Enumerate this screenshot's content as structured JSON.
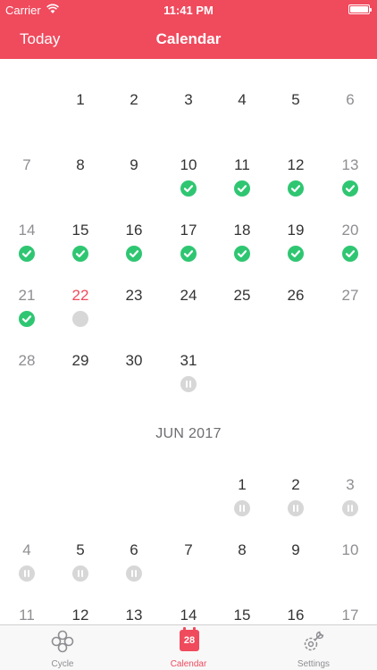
{
  "status_bar": {
    "carrier": "Carrier",
    "time": "11:41 PM"
  },
  "nav": {
    "today_label": "Today",
    "title": "Calendar"
  },
  "calendar": {
    "may": [
      {
        "d": "1",
        "col": 1,
        "row": 0
      },
      {
        "d": "2",
        "col": 2,
        "row": 0
      },
      {
        "d": "3",
        "col": 3,
        "row": 0
      },
      {
        "d": "4",
        "col": 4,
        "row": 0
      },
      {
        "d": "5",
        "col": 5,
        "row": 0
      },
      {
        "d": "6",
        "col": 6,
        "row": 0
      },
      {
        "d": "7",
        "col": 0,
        "row": 1
      },
      {
        "d": "8",
        "col": 1,
        "row": 1
      },
      {
        "d": "9",
        "col": 2,
        "row": 1
      },
      {
        "d": "10",
        "col": 3,
        "row": 1,
        "m": "check"
      },
      {
        "d": "11",
        "col": 4,
        "row": 1,
        "m": "check"
      },
      {
        "d": "12",
        "col": 5,
        "row": 1,
        "m": "check"
      },
      {
        "d": "13",
        "col": 6,
        "row": 1,
        "m": "check"
      },
      {
        "d": "14",
        "col": 0,
        "row": 2,
        "m": "check"
      },
      {
        "d": "15",
        "col": 1,
        "row": 2,
        "m": "check"
      },
      {
        "d": "16",
        "col": 2,
        "row": 2,
        "m": "check"
      },
      {
        "d": "17",
        "col": 3,
        "row": 2,
        "m": "check"
      },
      {
        "d": "18",
        "col": 4,
        "row": 2,
        "m": "check"
      },
      {
        "d": "19",
        "col": 5,
        "row": 2,
        "m": "check"
      },
      {
        "d": "20",
        "col": 6,
        "row": 2,
        "m": "check"
      },
      {
        "d": "21",
        "col": 0,
        "row": 3,
        "m": "check"
      },
      {
        "d": "22",
        "col": 1,
        "row": 3,
        "m": "dot",
        "today": true
      },
      {
        "d": "23",
        "col": 2,
        "row": 3
      },
      {
        "d": "24",
        "col": 3,
        "row": 3
      },
      {
        "d": "25",
        "col": 4,
        "row": 3
      },
      {
        "d": "26",
        "col": 5,
        "row": 3
      },
      {
        "d": "27",
        "col": 6,
        "row": 3
      },
      {
        "d": "28",
        "col": 0,
        "row": 4
      },
      {
        "d": "29",
        "col": 1,
        "row": 4
      },
      {
        "d": "30",
        "col": 2,
        "row": 4
      },
      {
        "d": "31",
        "col": 3,
        "row": 4,
        "m": "pause"
      }
    ],
    "june_label": "JUN 2017",
    "june": [
      {
        "d": "1",
        "col": 4,
        "row": 0,
        "m": "pause"
      },
      {
        "d": "2",
        "col": 5,
        "row": 0,
        "m": "pause"
      },
      {
        "d": "3",
        "col": 6,
        "row": 0,
        "m": "pause"
      },
      {
        "d": "4",
        "col": 0,
        "row": 1,
        "m": "pause"
      },
      {
        "d": "5",
        "col": 1,
        "row": 1,
        "m": "pause"
      },
      {
        "d": "6",
        "col": 2,
        "row": 1,
        "m": "pause"
      },
      {
        "d": "7",
        "col": 3,
        "row": 1
      },
      {
        "d": "8",
        "col": 4,
        "row": 1
      },
      {
        "d": "9",
        "col": 5,
        "row": 1
      },
      {
        "d": "10",
        "col": 6,
        "row": 1
      },
      {
        "d": "11",
        "col": 0,
        "row": 2
      },
      {
        "d": "12",
        "col": 1,
        "row": 2
      },
      {
        "d": "13",
        "col": 2,
        "row": 2
      },
      {
        "d": "14",
        "col": 3,
        "row": 2
      },
      {
        "d": "15",
        "col": 4,
        "row": 2
      },
      {
        "d": "16",
        "col": 5,
        "row": 2
      },
      {
        "d": "17",
        "col": 6,
        "row": 2
      }
    ]
  },
  "tabs": [
    {
      "label": "Cycle",
      "icon": "cycle-icon"
    },
    {
      "label": "Calendar",
      "icon": "calendar-icon",
      "badge": "28",
      "active": true
    },
    {
      "label": "Settings",
      "icon": "settings-icon"
    }
  ],
  "colors": {
    "accent": "#f04a5d",
    "check": "#2fc672",
    "inactive": "#d7d7d7"
  }
}
